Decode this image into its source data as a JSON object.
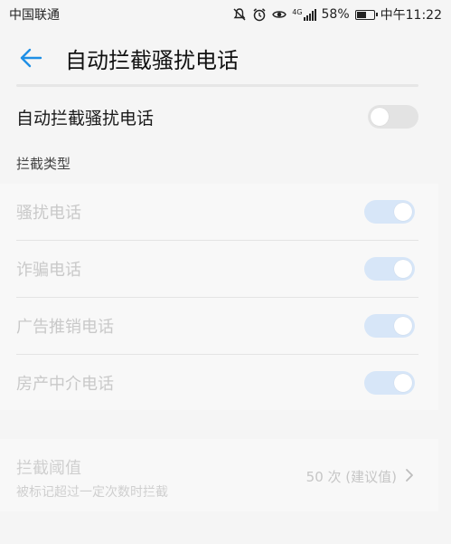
{
  "status_bar": {
    "carrier": "中国联通",
    "network": "4G",
    "battery": "58%",
    "battery_fraction": 0.58,
    "time": "中午11:22",
    "icons": [
      "mute-icon",
      "alarm-icon",
      "eye-icon",
      "signal-icon",
      "battery-icon"
    ]
  },
  "app_bar": {
    "title": "自动拦截骚扰电话",
    "back_icon": "arrow-left-icon",
    "accent": "#1f8fe5"
  },
  "main_toggle": {
    "label": "自动拦截骚扰电话",
    "on": false
  },
  "section": {
    "header": "拦截类型",
    "items": [
      {
        "label": "骚扰电话",
        "on": true
      },
      {
        "label": "诈骗电话",
        "on": true
      },
      {
        "label": "广告推销电话",
        "on": true
      },
      {
        "label": "房产中介电话",
        "on": true
      }
    ]
  },
  "threshold": {
    "title": "拦截阈值",
    "subtitle": "被标记超过一定次数时拦截",
    "value": "50 次 (建议值)",
    "chevron_icon": "chevron-right-icon"
  },
  "colors": {
    "background": "#f5f5f5",
    "toggle_off": "#e3e3e3",
    "toggle_on_disabled": "#d7e6f8",
    "disabled_text": "#c9c9c9"
  }
}
